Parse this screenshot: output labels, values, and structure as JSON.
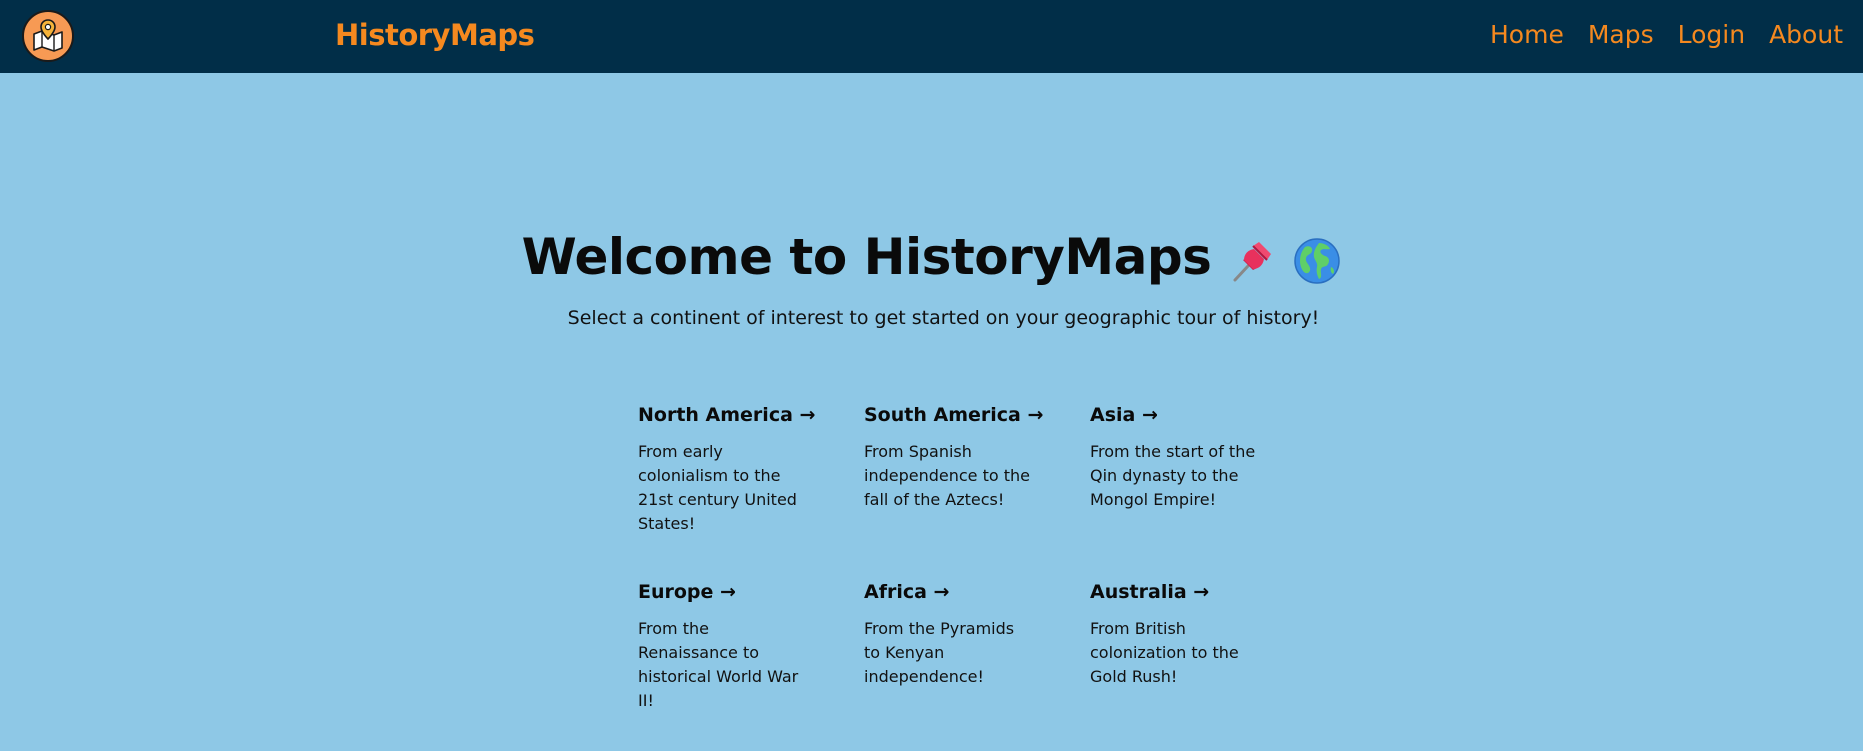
{
  "header": {
    "brand": "HistoryMaps",
    "logo_icon": "map-pin-icon",
    "nav": [
      {
        "label": "Home"
      },
      {
        "label": "Maps"
      },
      {
        "label": "Login"
      },
      {
        "label": "About"
      }
    ]
  },
  "hero": {
    "title": "Welcome to HistoryMaps",
    "title_icons": [
      "pushpin-icon",
      "globe-icon"
    ],
    "subtitle": "Select a continent of interest to get started on your geographic tour of history!"
  },
  "continents": [
    {
      "title": "North America →",
      "description": "From early colonialism to the 21st century United States!"
    },
    {
      "title": "South America →",
      "description": "From Spanish independence to the fall of the Aztecs!"
    },
    {
      "title": "Asia →",
      "description": "From the start of the Qin dynasty to the Mongol Empire!"
    },
    {
      "title": "Europe →",
      "description": "From the Renaissance to historical World War II!"
    },
    {
      "title": "Africa →",
      "description": "From the Pyramids to Kenyan independence!"
    },
    {
      "title": "Australia →",
      "description": "From British colonization to the Gold Rush!"
    }
  ],
  "colors": {
    "navbar_bg": "#012e48",
    "accent": "#f5891f",
    "page_bg": "#8ec8e6"
  }
}
